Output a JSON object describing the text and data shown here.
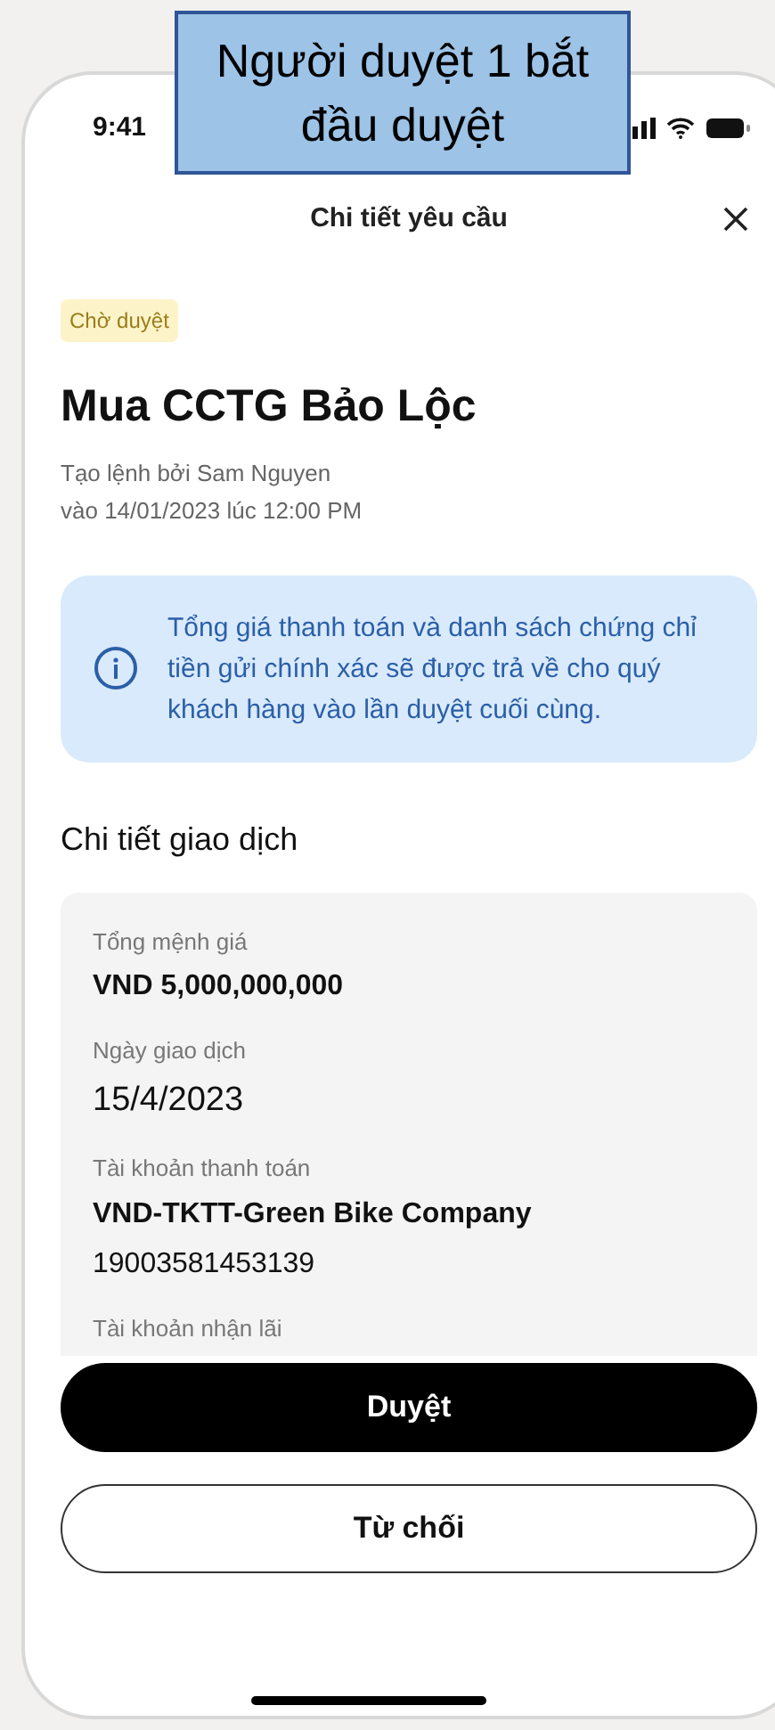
{
  "annotation": {
    "text": "Người duyệt 1 bắt đầu duyệt"
  },
  "status_bar": {
    "time": "9:41"
  },
  "header": {
    "title": "Chi tiết yêu cầu"
  },
  "status_badge": {
    "text": "Chờ duyệt",
    "kind": "pending"
  },
  "request": {
    "title": "Mua CCTG Bảo Lộc",
    "created_by": "Tạo lệnh bởi Sam Nguyen",
    "created_at": "vào 14/01/2023 lúc 12:00 PM"
  },
  "info_note": {
    "text": "Tổng giá thanh toán và danh sách chứng chỉ tiền gửi chính xác sẽ được trả về cho quý khách hàng vào lần duyệt cuối cùng."
  },
  "details": {
    "title": "Chi tiết giao dịch",
    "fields": [
      {
        "label": "Tổng mệnh giá",
        "value": "VND 5,000,000,000",
        "kind": "bold"
      },
      {
        "label": "Ngày giao dịch",
        "value": "15/4/2023",
        "kind": "large"
      },
      {
        "label": "Tài khoản thanh toán",
        "value": "VND-TKTT-Green Bike Company",
        "extra": "19003581453139",
        "kind": "bold"
      },
      {
        "label": "Tài khoản nhận lãi",
        "kind": "label_only"
      }
    ]
  },
  "actions": [
    {
      "label": "Duyệt",
      "kind": "primary"
    },
    {
      "label": "Từ chối",
      "kind": "secondary"
    }
  ]
}
